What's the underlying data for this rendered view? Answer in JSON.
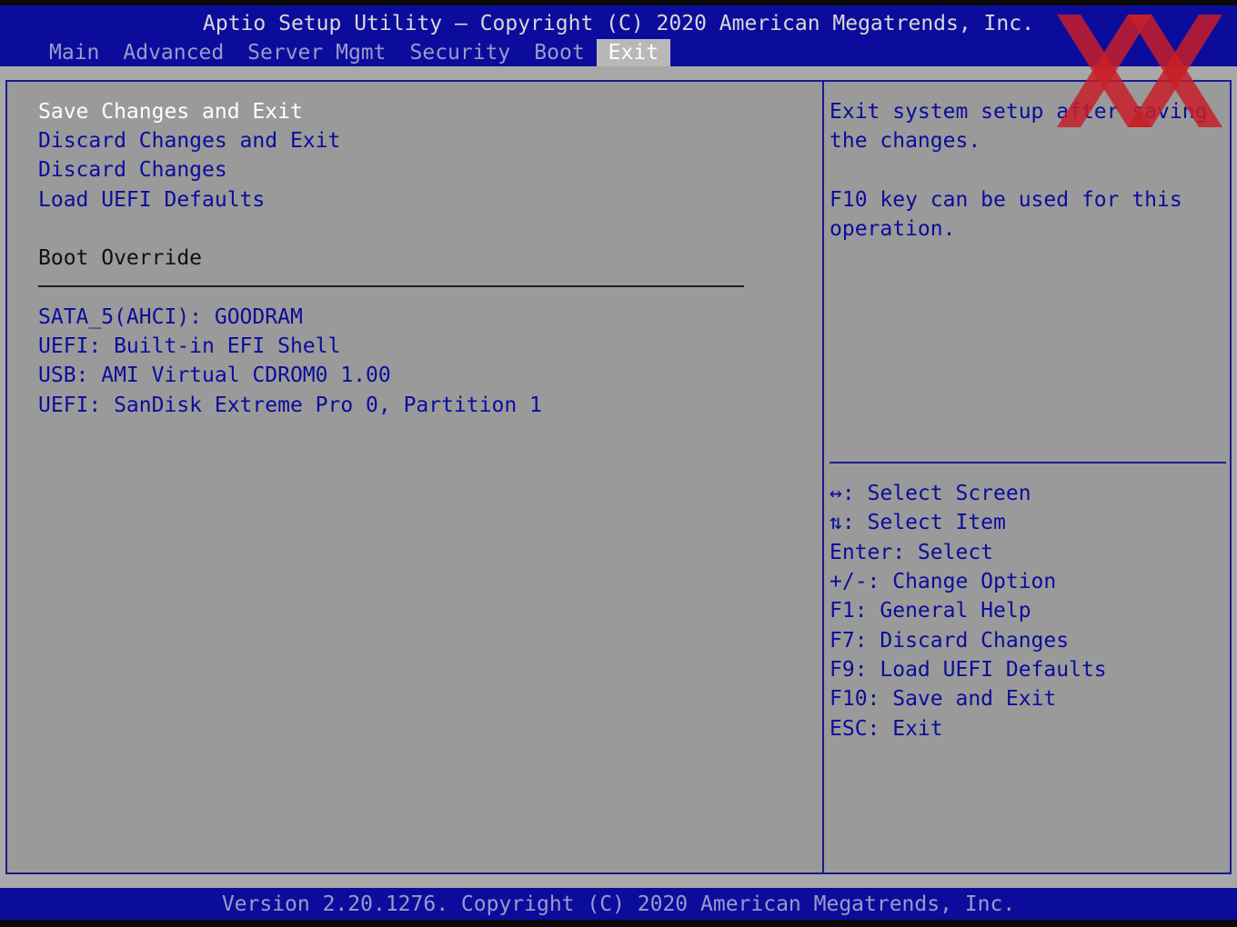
{
  "header": {
    "title": "Aptio Setup Utility – Copyright (C) 2020 American Megatrends, Inc."
  },
  "tabs": [
    {
      "label": "Main"
    },
    {
      "label": "Advanced"
    },
    {
      "label": "Server Mgmt"
    },
    {
      "label": "Security"
    },
    {
      "label": "Boot"
    },
    {
      "label": "Exit",
      "active": true
    }
  ],
  "menu": {
    "items": [
      {
        "label": "Save Changes and Exit",
        "selected": true
      },
      {
        "label": "Discard Changes and Exit"
      },
      {
        "label": "Discard Changes"
      },
      {
        "label": "Load UEFI Defaults"
      }
    ],
    "boot_override_label": "Boot Override",
    "boot_devices": [
      {
        "label": "SATA_5(AHCI): GOODRAM"
      },
      {
        "label": "UEFI: Built-in EFI Shell"
      },
      {
        "label": "USB: AMI Virtual CDROM0 1.00"
      },
      {
        "label": "UEFI: SanDisk Extreme Pro 0, Partition 1"
      }
    ]
  },
  "help": {
    "lines": [
      "Exit system setup after saving",
      "the changes.",
      "",
      "F10 key can be used for this",
      "operation."
    ]
  },
  "keys": [
    "↔: Select Screen",
    "⇅: Select Item",
    "Enter: Select",
    "+/-: Change Option",
    "F1: General Help",
    "F7: Discard Changes",
    "F9: Load UEFI Defaults",
    "F10: Save and Exit",
    "ESC: Exit"
  ],
  "footer": {
    "text": "Version 2.20.1276. Copyright (C) 2020 American Megatrends, Inc."
  },
  "colors": {
    "header_bg": "#0c0c9c",
    "panel_bg": "#9a9a9a",
    "item_text": "#0c0c9c",
    "selected_text": "#ffffff",
    "logo_red": "#c81e28"
  },
  "logo_icon": "double-x-watermark-icon"
}
